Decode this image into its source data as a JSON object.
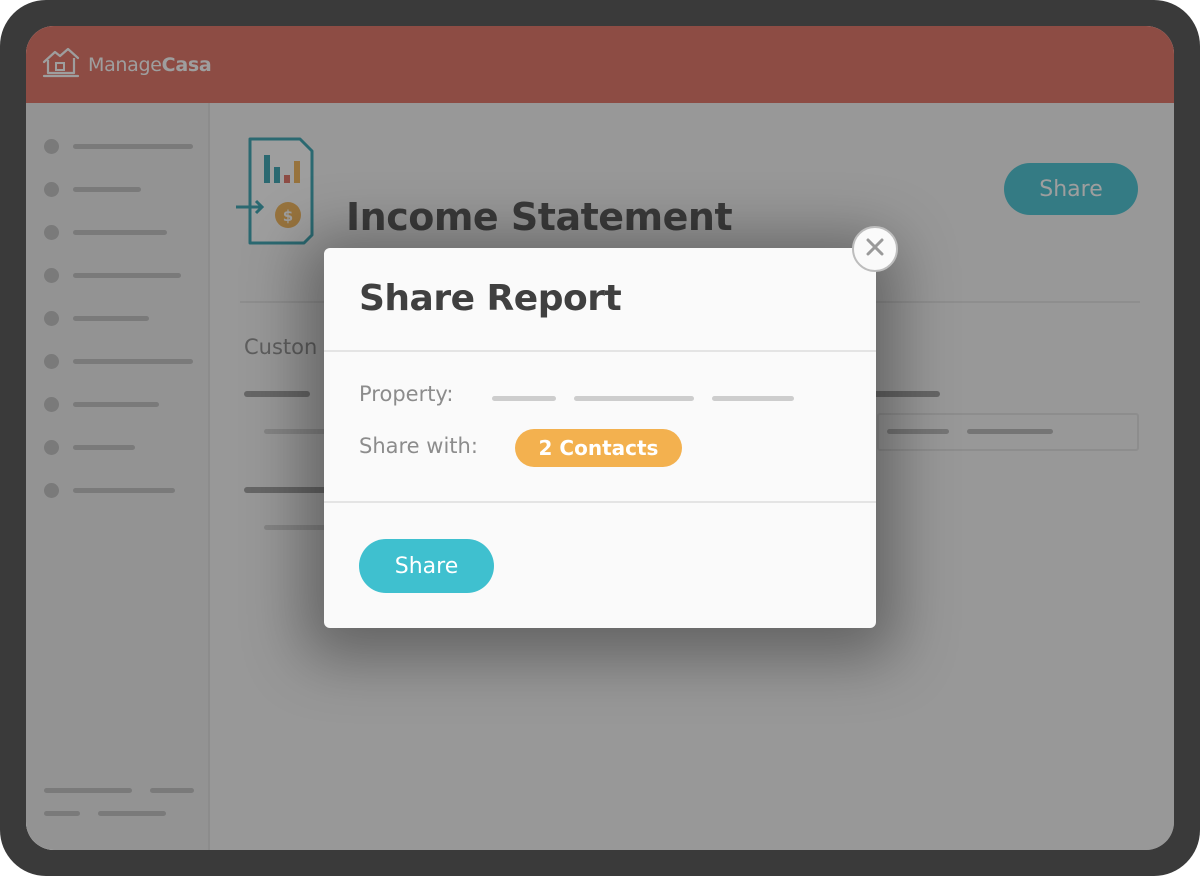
{
  "app": {
    "logo_prefix": "Manage",
    "logo_suffix": "Casa",
    "logo_icon": "house-icon"
  },
  "page": {
    "title": "Income Statement",
    "share_label": "Share",
    "custom_label": "Custon",
    "report_icon": "income-report-icon"
  },
  "modal": {
    "title": "Share Report",
    "property_label": "Property:",
    "share_with_label": "Share with:",
    "contacts_badge": "2 Contacts",
    "share_button": "Share",
    "close_icon": "close-icon"
  },
  "colors": {
    "header": "#e06a5c",
    "primary_button": "#3fc0cf",
    "badge": "#f3b14f"
  }
}
